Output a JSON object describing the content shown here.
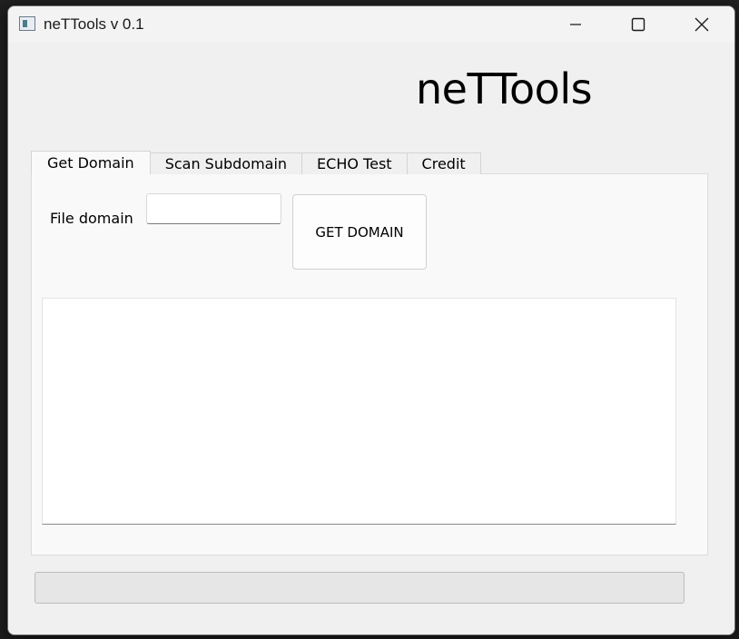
{
  "window": {
    "title": "neTTools v 0.1"
  },
  "app": {
    "heading": "neTTools"
  },
  "tabs": [
    {
      "label": "Get Domain",
      "active": true
    },
    {
      "label": "Scan Subdomain",
      "active": false
    },
    {
      "label": "ECHO Test",
      "active": false
    },
    {
      "label": "Credit",
      "active": false
    }
  ],
  "get_domain": {
    "field_label": "File domain",
    "input_value": "",
    "button_label": "GET DOMAIN",
    "output_text": ""
  },
  "progress": {
    "value": 0
  },
  "colors": {
    "window_bg": "#f0f0f0",
    "pane_bg": "#f9f9f9",
    "progress_fill": "#06b025"
  },
  "icons": {
    "app": "app-window-icon",
    "minimize": "minimize-icon",
    "maximize": "maximize-icon",
    "close": "close-icon"
  }
}
